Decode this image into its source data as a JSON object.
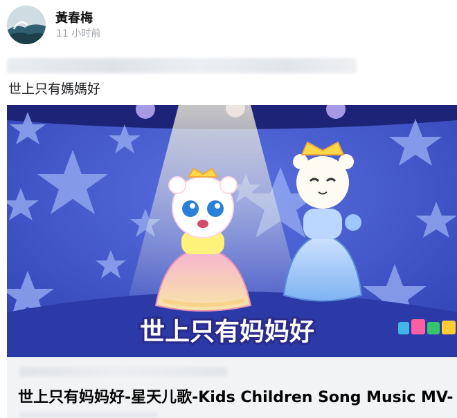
{
  "post": {
    "author": "黃春梅",
    "time": "11 小时前",
    "text": "世上只有媽媽好"
  },
  "media": {
    "overlay_title": "世上只有妈妈好"
  },
  "link": {
    "title": "世上只有妈妈好-星天儿歌-Kids Children Song Music MV-"
  }
}
